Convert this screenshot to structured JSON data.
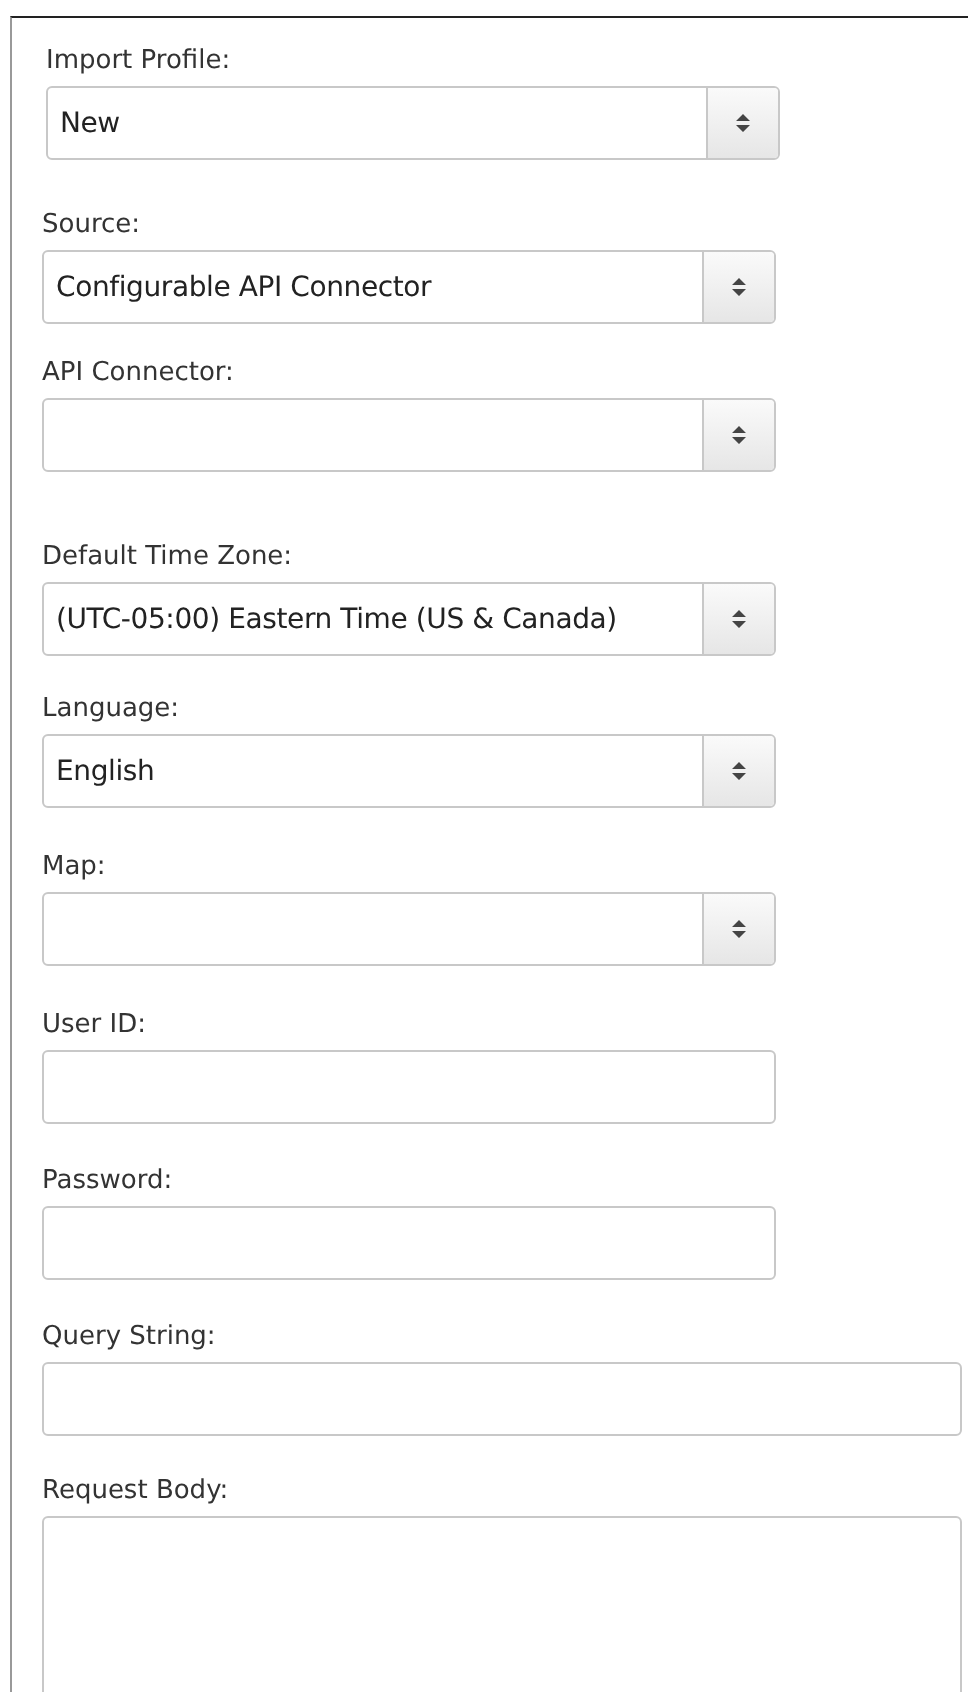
{
  "fields": [
    {
      "label": "Import Profile:",
      "kind": "select",
      "value": "New"
    },
    {
      "label": "Source:",
      "kind": "select",
      "value": "Configurable API Connector"
    },
    {
      "label": "API Connector:",
      "kind": "select"
    },
    {
      "label": "Default Time Zone:",
      "kind": "select",
      "value": "(UTC-05:00) Eastern Time (US & Canada)"
    },
    {
      "label": "Language:",
      "kind": "select",
      "value": "English"
    },
    {
      "label": "Map:",
      "kind": "select"
    },
    {
      "label": "User ID:",
      "kind": "input"
    },
    {
      "label": "Password:",
      "kind": "input"
    },
    {
      "label": "Query String:",
      "kind": "wide-input"
    },
    {
      "label": "Request Body:",
      "kind": "textarea"
    }
  ]
}
